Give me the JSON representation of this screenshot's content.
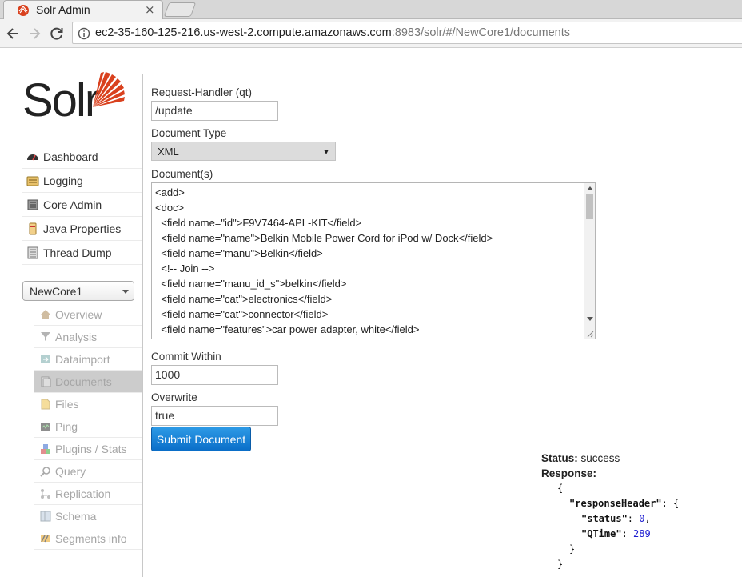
{
  "browser": {
    "tab_title": "Solr Admin",
    "tab_close": "×",
    "url_host": "ec2-35-160-125-216.us-west-2.compute.amazonaws.com",
    "url_rest": ":8983/solr/#/NewCore1/documents"
  },
  "logo": {
    "text": "Solr"
  },
  "main_menu": [
    {
      "label": "Dashboard",
      "icon": "dashboard-icon"
    },
    {
      "label": "Logging",
      "icon": "logging-icon"
    },
    {
      "label": "Core Admin",
      "icon": "core-admin-icon"
    },
    {
      "label": "Java Properties",
      "icon": "java-properties-icon"
    },
    {
      "label": "Thread Dump",
      "icon": "thread-dump-icon"
    }
  ],
  "core_selector": {
    "selected": "NewCore1"
  },
  "core_menu": [
    {
      "label": "Overview",
      "icon": "home-icon"
    },
    {
      "label": "Analysis",
      "icon": "funnel-icon"
    },
    {
      "label": "Dataimport",
      "icon": "dataimport-icon"
    },
    {
      "label": "Documents",
      "icon": "documents-icon"
    },
    {
      "label": "Files",
      "icon": "files-icon"
    },
    {
      "label": "Ping",
      "icon": "ping-icon"
    },
    {
      "label": "Plugins / Stats",
      "icon": "plugins-icon"
    },
    {
      "label": "Query",
      "icon": "query-icon"
    },
    {
      "label": "Replication",
      "icon": "replication-icon"
    },
    {
      "label": "Schema",
      "icon": "schema-icon"
    },
    {
      "label": "Segments info",
      "icon": "segments-icon"
    }
  ],
  "form": {
    "request_handler_label": "Request-Handler (qt)",
    "request_handler_value": "/update",
    "document_type_label": "Document Type",
    "document_type_value": "XML",
    "documents_label": "Document(s)",
    "documents_lines": [
      "<add>",
      "<doc>",
      "  <field name=\"id\">F9V7464-APL-KIT</field>",
      "  <field name=\"name\">Belkin Mobile Power Cord for iPod w/ Dock</field>",
      "  <field name=\"manu\">Belkin</field>",
      "  <!-- Join -->",
      "  <field name=\"manu_id_s\">belkin</field>",
      "  <field name=\"cat\">electronics</field>",
      "  <field name=\"cat\">connector</field>",
      "  <field name=\"features\">car power adapter, white</field>"
    ],
    "commit_within_label": "Commit Within",
    "commit_within_value": "1000",
    "overwrite_label": "Overwrite",
    "overwrite_value": "true",
    "submit_label": "Submit Document"
  },
  "response": {
    "status_label": "Status:",
    "status_value": "success",
    "response_label": "Response:",
    "json_open": "{",
    "response_header_key": "\"responseHeader\"",
    "response_header_open": ": {",
    "status_key": "\"status\"",
    "status_num": "0",
    "qtime_key": "\"QTime\"",
    "qtime_num": "289",
    "inner_close": "}",
    "json_close": "}"
  },
  "colors": {
    "solr_orange": "#d9411e",
    "submit_blue": "#0a6ec8",
    "active_menu_bg": "#cccccc"
  }
}
